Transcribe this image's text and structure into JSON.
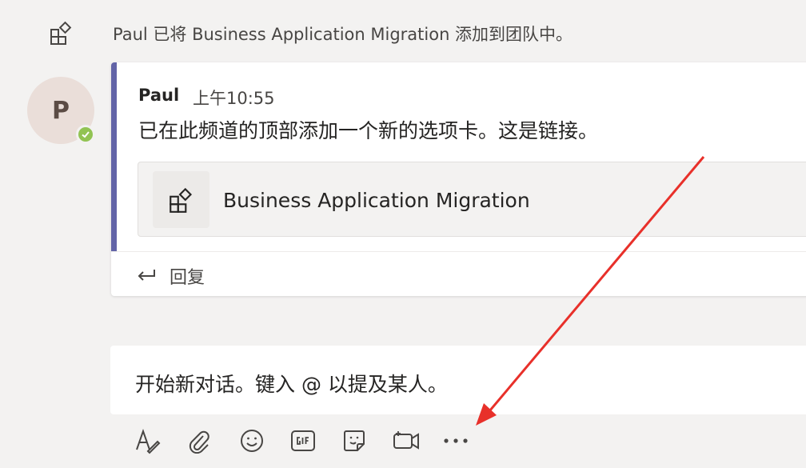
{
  "system_message": {
    "text": "Paul 已将 Business Application Migration 添加到团队中。"
  },
  "post": {
    "avatar_initial": "P",
    "author": "Paul",
    "time": "上午10:55",
    "message": "已在此频道的顶部添加一个新的选项卡。这是链接。",
    "tab_card_title": "Business Application Migration",
    "reply_label": "回复"
  },
  "compose": {
    "placeholder": "开始新对话。键入 @ 以提及某人。"
  },
  "toolbar": {
    "items": [
      {
        "icon": "format-icon"
      },
      {
        "icon": "attach-icon"
      },
      {
        "icon": "emoji-icon"
      },
      {
        "icon": "gif-icon"
      },
      {
        "icon": "sticker-icon"
      },
      {
        "icon": "meet-now-icon"
      },
      {
        "icon": "more-options-icon"
      }
    ]
  },
  "colors": {
    "accent": "#6264a7",
    "presence": "#92c353",
    "annotation_arrow": "#e8302a",
    "background": "#f3f2f1"
  }
}
